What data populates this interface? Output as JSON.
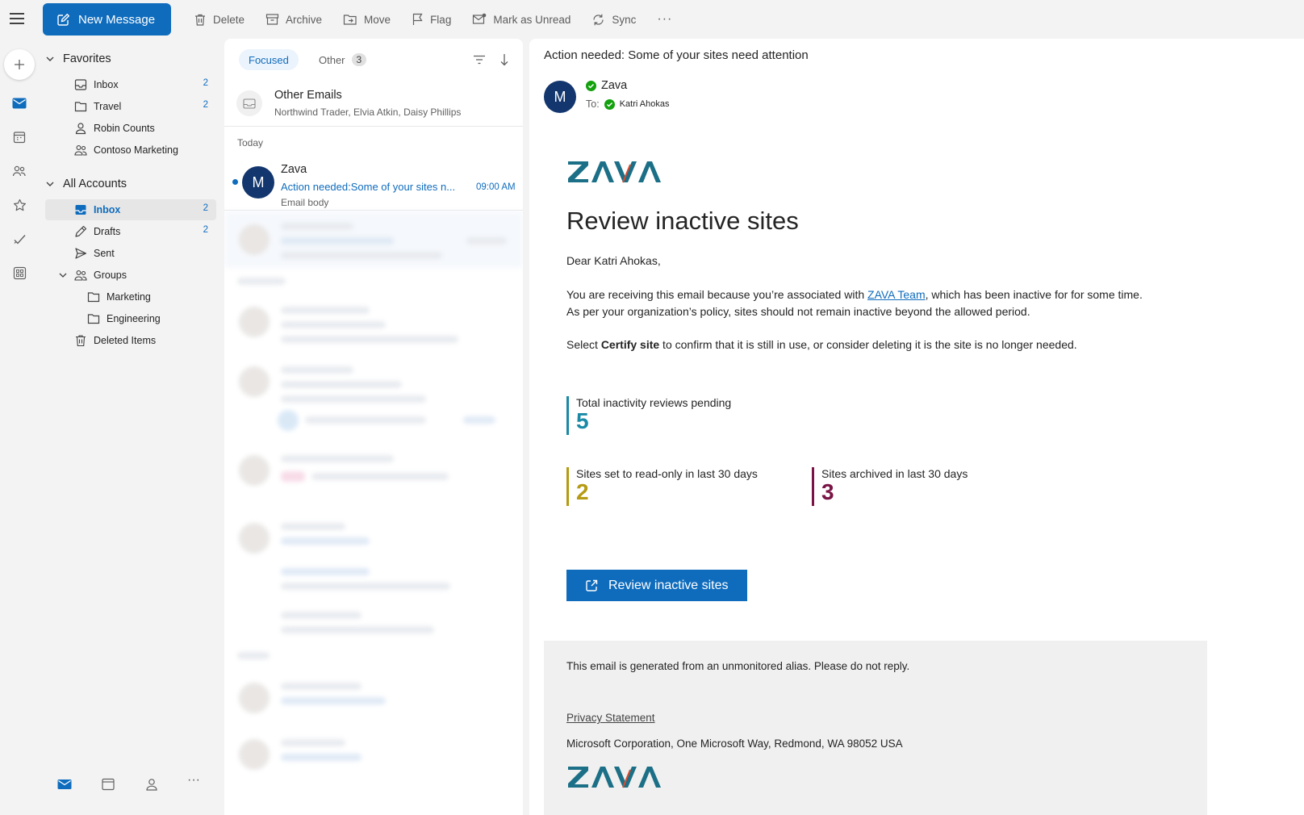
{
  "toolbar": {
    "new_message": "New Message",
    "delete": "Delete",
    "archive": "Archive",
    "move": "Move",
    "flag": "Flag",
    "mark_unread": "Mark as Unread",
    "sync": "Sync",
    "more": "···"
  },
  "favorites": {
    "title": "Favorites",
    "items": [
      {
        "label": "Inbox",
        "count": "2"
      },
      {
        "label": "Travel",
        "count": "2"
      },
      {
        "label": "Robin Counts",
        "count": ""
      },
      {
        "label": "Contoso Marketing",
        "count": ""
      }
    ]
  },
  "all_accounts": {
    "title": "All Accounts",
    "items": [
      {
        "label": "Inbox",
        "count": "2"
      },
      {
        "label": "Drafts",
        "count": "2"
      },
      {
        "label": "Sent",
        "count": ""
      },
      {
        "label": "Groups",
        "count": ""
      },
      {
        "label": "Marketing",
        "count": ""
      },
      {
        "label": "Engineering",
        "count": ""
      },
      {
        "label": "Deleted Items",
        "count": ""
      }
    ]
  },
  "bottom_nav": {
    "more": "···"
  },
  "list": {
    "tab_focused": "Focused",
    "tab_other": "Other",
    "other_count": "3",
    "other_emails_title": "Other Emails",
    "other_emails_senders": "Northwind Trader, Elvia Atkin, Daisy Phillips",
    "group_today": "Today",
    "message": {
      "sender": "Zava",
      "avatar": "M",
      "subject": "Action needed:Some of your sites n...",
      "time": "09:00 AM",
      "preview": "Email body"
    }
  },
  "reading": {
    "subject": "Action needed: Some of your sites need attention",
    "avatar": "M",
    "from": "Zava",
    "to_label": "To:",
    "to": "Katri Ahokas",
    "email": {
      "logo_text": "ZAVA",
      "heading": "Review inactive sites",
      "greeting": "Dear Katri Ahokas,",
      "p1_before": "You are receiving this email because you’re associated with ",
      "p1_link": "ZAVA Team",
      "p1_after": ", which has been inactive for for some time. As per your organization’s policy, sites should not remain inactive beyond the allowed period.",
      "p2_before": "Select ",
      "p2_bold": "Certify site",
      "p2_after": " to confirm that it is still in use, or consider deleting it is the site is no longer needed.",
      "stats": [
        {
          "label": "Total inactivity reviews pending",
          "value": "5",
          "color": "#1a8aa6"
        },
        {
          "label": "Sites set to read-only in last 30 days",
          "value": "2",
          "color": "#b59a12"
        },
        {
          "label": "Sites archived in last 30 days",
          "value": "3",
          "color": "#7a1446"
        }
      ],
      "cta": "Review inactive sites",
      "footer_note": "This email is generated from an unmonitored alias. Please do not reply.",
      "privacy": "Privacy Statement",
      "address": "Microsoft Corporation, One Microsoft Way, Redmond, WA 98052 USA"
    }
  },
  "colors": {
    "accent": "#0f6cbd",
    "avatar": "#12366d",
    "logo_primary": "#1b6f86",
    "logo_accent": "#d94b2b"
  }
}
